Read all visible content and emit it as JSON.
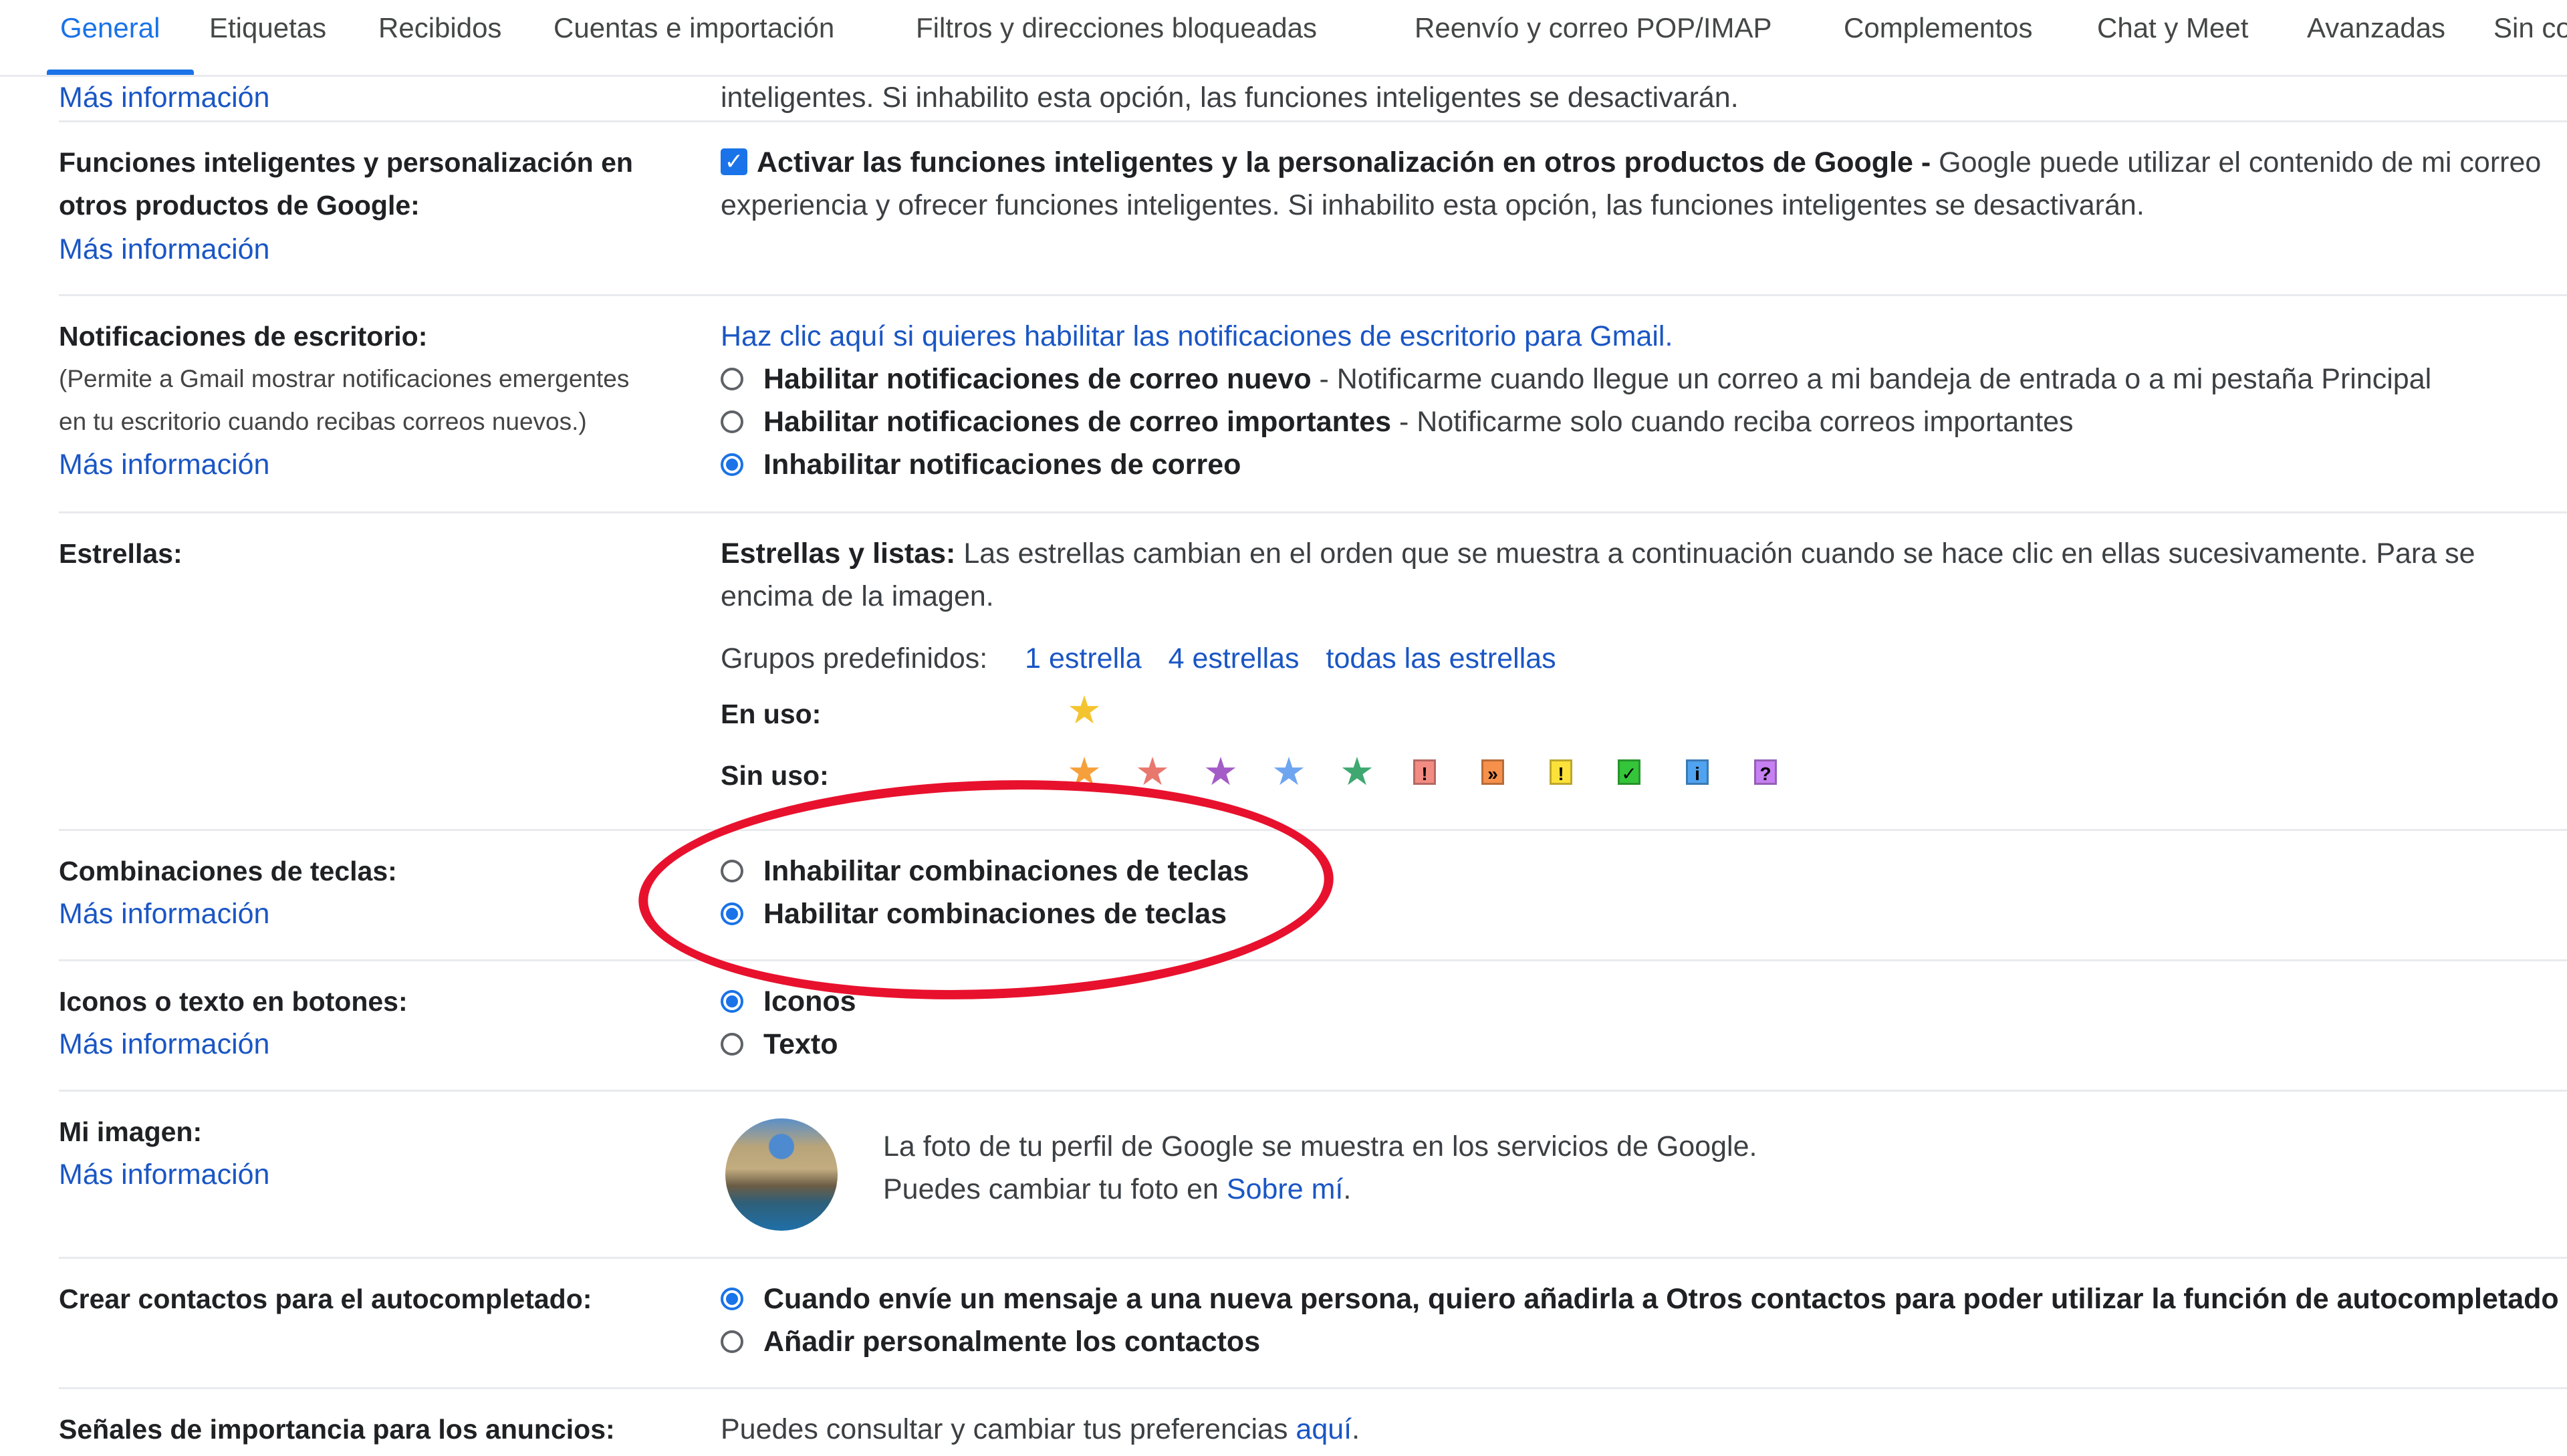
{
  "tabs": [
    {
      "label": "General",
      "active": true
    },
    {
      "label": "Etiquetas"
    },
    {
      "label": "Recibidos"
    },
    {
      "label": "Cuentas e importación"
    },
    {
      "label": "Filtros y direcciones bloqueadas"
    },
    {
      "label": "Reenvío y correo POP/IMAP"
    },
    {
      "label": "Complementos"
    },
    {
      "label": "Chat y Meet"
    },
    {
      "label": "Avanzadas"
    },
    {
      "label": "Sin conexión"
    }
  ],
  "more_info": "Más información",
  "top_cut": {
    "value": "inteligentes. Si inhabilito esta opción, las funciones inteligentes se desactivarán."
  },
  "smart_features": {
    "label": "Funciones inteligentes y personalización en otros productos de Google:",
    "checkbox_checked": true,
    "option_bold": "Activar las funciones inteligentes y la personalización en otros productos de Google -",
    "option_text": " Google puede utilizar el contenido de mi correo",
    "line2": "experiencia y ofrecer funciones inteligentes. Si inhabilito esta opción, las funciones inteligentes se desactivarán."
  },
  "desktop_notifications": {
    "label": "Notificaciones de escritorio:",
    "sub1": "(Permite a Gmail mostrar notificaciones emergentes",
    "sub2": "en tu escritorio cuando recibas correos nuevos.)",
    "enable_link": "Haz clic aquí si quieres habilitar las notificaciones de escritorio para Gmail.",
    "options": [
      {
        "bold": "Habilitar notificaciones de correo nuevo",
        "text": " - Notificarme cuando llegue un correo a mi bandeja de entrada o a mi pestaña Principal",
        "selected": false
      },
      {
        "bold": "Habilitar notificaciones de correo importantes",
        "text": " - Notificarme solo cuando reciba correos importantes",
        "selected": false
      },
      {
        "bold": "Inhabilitar notificaciones de correo",
        "text": "",
        "selected": true
      }
    ]
  },
  "stars": {
    "label": "Estrellas:",
    "desc_bold": "Estrellas y listas:",
    "desc_text": " Las estrellas cambian en el orden que se muestra a continuación cuando se hace clic en ellas sucesivamente. Para se",
    "desc_line2": "encima de la imagen.",
    "presets_label": "Grupos predefinidos:",
    "presets": [
      "1 estrella",
      "4 estrellas",
      "todas las estrellas"
    ],
    "in_use_label": "En uso:",
    "not_in_use_label": "Sin uso:",
    "in_use": [
      {
        "name": "yellow-star",
        "glyph": "★",
        "color": "#f4c430"
      }
    ],
    "not_in_use": [
      {
        "name": "orange-star",
        "glyph": "★",
        "color": "#f6a03c"
      },
      {
        "name": "red-star",
        "glyph": "★",
        "color": "#e8776d"
      },
      {
        "name": "purple-star",
        "glyph": "★",
        "color": "#a45cc7"
      },
      {
        "name": "blue-star",
        "glyph": "★",
        "color": "#6ea5f0"
      },
      {
        "name": "green-star",
        "glyph": "★",
        "color": "#3fa871"
      },
      {
        "name": "red-bang",
        "glyph": "!",
        "color": "#f28b82"
      },
      {
        "name": "orange-guillemet",
        "glyph": "»",
        "color": "#f6904a"
      },
      {
        "name": "yellow-bang",
        "glyph": "!",
        "color": "#fde13b"
      },
      {
        "name": "green-check",
        "glyph": "✓",
        "color": "#34c53a"
      },
      {
        "name": "blue-info",
        "glyph": "i",
        "color": "#4fa3f0"
      },
      {
        "name": "purple-question",
        "glyph": "?",
        "color": "#c680f2"
      }
    ]
  },
  "shortcuts": {
    "label": "Combinaciones de teclas:",
    "options": [
      {
        "label": "Inhabilitar combinaciones de teclas",
        "selected": false
      },
      {
        "label": "Habilitar combinaciones de teclas",
        "selected": true
      }
    ],
    "highlight_color": "#e8112d"
  },
  "button_labels": {
    "label": "Iconos o texto en botones:",
    "options": [
      {
        "label": "Iconos",
        "selected": true
      },
      {
        "label": "Texto",
        "selected": false
      }
    ]
  },
  "my_picture": {
    "label": "Mi imagen:",
    "line1": "La foto de tu perfil de Google se muestra en los servicios de Google.",
    "line2_prefix": "Puedes cambiar tu foto en ",
    "line2_link": "Sobre mí",
    "line2_suffix": "."
  },
  "autocomplete": {
    "label": "Crear contactos para el autocompletado:",
    "options": [
      {
        "label": "Cuando envíe un mensaje a una nueva persona, quiero añadirla a Otros contactos para poder utilizar la función de autocompletado",
        "selected": true
      },
      {
        "label": "Añadir personalmente los contactos",
        "selected": false
      }
    ]
  },
  "ad_signals": {
    "label": "Señales de importancia para los anuncios:",
    "text": "Puedes consultar y cambiar tus preferencias ",
    "link": "aquí",
    "suffix": "."
  },
  "colors": {
    "accent": "#1a73e8",
    "link": "#1a56c4"
  }
}
